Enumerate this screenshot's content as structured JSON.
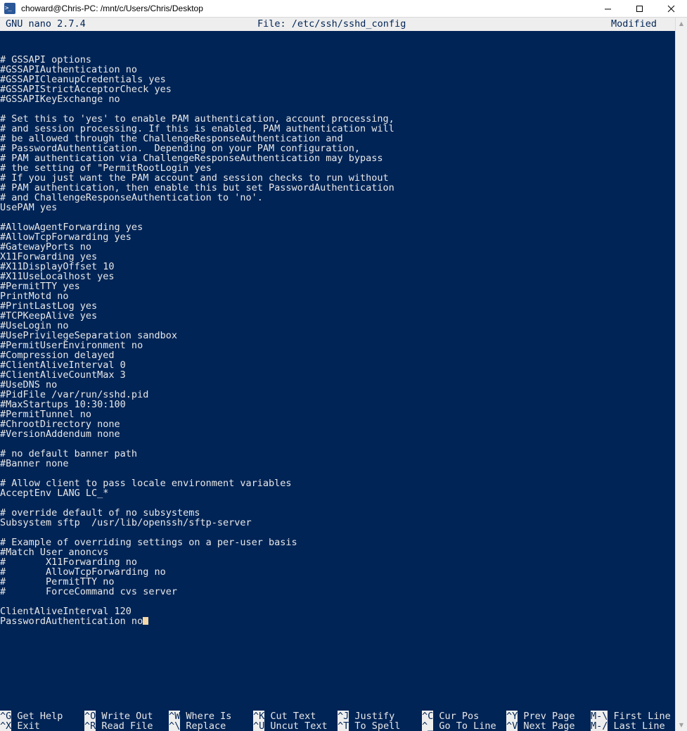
{
  "window": {
    "icon": "terminal-prompt-icon",
    "title": "choward@Chris-PC: /mnt/c/Users/Chris/Desktop",
    "minimize_label": "—",
    "maximize_label": "□",
    "close_label": "✕"
  },
  "colors": {
    "terminal_background": "#012456",
    "terminal_text": "#e8e8e8",
    "bar_background": "#eeeeee",
    "bar_text": "#012456",
    "cursor": "#f5d7a8",
    "window_icon": "#2b5797"
  },
  "nano_header": {
    "version": "GNU nano 2.7.4",
    "file": "File: /etc/ssh/sshd_config",
    "status": "Modified"
  },
  "editor": {
    "cursor_line_index": 57,
    "lines": [
      "# GSSAPI options",
      "#GSSAPIAuthentication no",
      "#GSSAPICleanupCredentials yes",
      "#GSSAPIStrictAcceptorCheck yes",
      "#GSSAPIKeyExchange no",
      "",
      "# Set this to 'yes' to enable PAM authentication, account processing,",
      "# and session processing. If this is enabled, PAM authentication will",
      "# be allowed through the ChallengeResponseAuthentication and",
      "# PasswordAuthentication.  Depending on your PAM configuration,",
      "# PAM authentication via ChallengeResponseAuthentication may bypass",
      "# the setting of \"PermitRootLogin yes",
      "# If you just want the PAM account and session checks to run without",
      "# PAM authentication, then enable this but set PasswordAuthentication",
      "# and ChallengeResponseAuthentication to 'no'.",
      "UsePAM yes",
      "",
      "#AllowAgentForwarding yes",
      "#AllowTcpForwarding yes",
      "#GatewayPorts no",
      "X11Forwarding yes",
      "#X11DisplayOffset 10",
      "#X11UseLocalhost yes",
      "#PermitTTY yes",
      "PrintMotd no",
      "#PrintLastLog yes",
      "#TCPKeepAlive yes",
      "#UseLogin no",
      "#UsePrivilegeSeparation sandbox",
      "#PermitUserEnvironment no",
      "#Compression delayed",
      "#ClientAliveInterval 0",
      "#ClientAliveCountMax 3",
      "#UseDNS no",
      "#PidFile /var/run/sshd.pid",
      "#MaxStartups 10:30:100",
      "#PermitTunnel no",
      "#ChrootDirectory none",
      "#VersionAddendum none",
      "",
      "# no default banner path",
      "#Banner none",
      "",
      "# Allow client to pass locale environment variables",
      "AcceptEnv LANG LC_*",
      "",
      "# override default of no subsystems",
      "Subsystem sftp  /usr/lib/openssh/sftp-server",
      "",
      "# Example of overriding settings on a per-user basis",
      "#Match User anoncvs",
      "#       X11Forwarding no",
      "#       AllowTcpForwarding no",
      "#       PermitTTY no",
      "#       ForceCommand cvs server",
      "",
      "ClientAliveInterval 120",
      "PasswordAuthentication no"
    ]
  },
  "scrollbar": {
    "up_arrow": "▲",
    "down_arrow": "▼"
  },
  "shortcuts": {
    "row1": [
      {
        "key": "^G",
        "label": "Get Help"
      },
      {
        "key": "^O",
        "label": "Write Out"
      },
      {
        "key": "^W",
        "label": "Where Is"
      },
      {
        "key": "^K",
        "label": "Cut Text"
      },
      {
        "key": "^J",
        "label": "Justify"
      },
      {
        "key": "^C",
        "label": "Cur Pos"
      },
      {
        "key": "^Y",
        "label": "Prev Page"
      },
      {
        "key": "M-\\",
        "label": "First Line"
      }
    ],
    "row2": [
      {
        "key": "^X",
        "label": "Exit"
      },
      {
        "key": "^R",
        "label": "Read File"
      },
      {
        "key": "^\\",
        "label": "Replace"
      },
      {
        "key": "^U",
        "label": "Uncut Text"
      },
      {
        "key": "^T",
        "label": "To Spell"
      },
      {
        "key": "^_",
        "label": "Go To Line"
      },
      {
        "key": "^V",
        "label": "Next Page"
      },
      {
        "key": "M-/",
        "label": "Last Line"
      }
    ],
    "column_x": [
      0,
      120,
      240,
      360,
      480,
      600,
      720,
      840
    ]
  }
}
